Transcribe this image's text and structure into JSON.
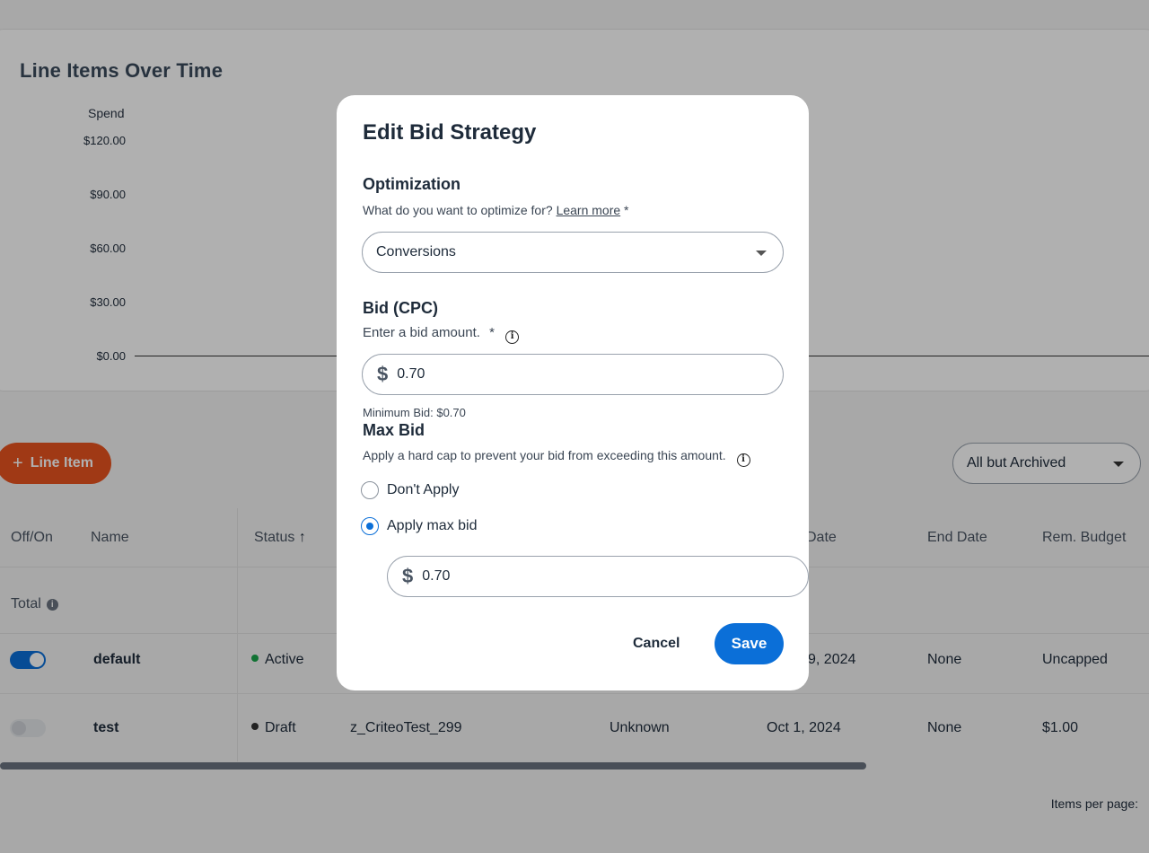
{
  "chart": {
    "title": "Line Items Over Time",
    "y_title": "Spend",
    "y_ticks": [
      "$120.00",
      "$90.00",
      "$60.00",
      "$30.00",
      "$0.00"
    ]
  },
  "toolbar": {
    "add_label": "Line Item",
    "filter_value": "All but Archived"
  },
  "table": {
    "headers": {
      "off_on": "Off/On",
      "name": "Name",
      "status": "Status",
      "start_date_partial": "Date",
      "end_date": "End Date",
      "rem_budget": "Rem. Budget"
    },
    "total_label": "Total",
    "rows": [
      {
        "enabled": true,
        "name": "default",
        "status": "Active",
        "status_color": "#1aa64b",
        "campaign": "",
        "tracking": "",
        "start_date_partial": "9, 2024",
        "end_date": "None",
        "rem_budget": "Uncapped"
      },
      {
        "enabled": false,
        "name": "test",
        "status": "Draft",
        "status_color": "#333333",
        "campaign": "z_CriteoTest_299",
        "tracking": "Unknown",
        "start_date": "Oct 1, 2024",
        "end_date": "None",
        "rem_budget": "$1.00"
      }
    ]
  },
  "pagination": {
    "items_per_page_label": "Items per page:"
  },
  "modal": {
    "title": "Edit Bid Strategy",
    "optimization": {
      "heading": "Optimization",
      "question": "What do you want to optimize for?",
      "learn_more": "Learn more",
      "required": "*",
      "selected": "Conversions"
    },
    "bid": {
      "heading": "Bid (CPC)",
      "prompt": "Enter a bid amount.",
      "required": "*",
      "currency": "$",
      "value": "0.70",
      "minimum_hint": "Minimum Bid: $0.70"
    },
    "max_bid": {
      "heading": "Max Bid",
      "description": "Apply a hard cap to prevent your bid from exceeding this amount.",
      "option_dont_apply": "Don't Apply",
      "option_apply": "Apply max bid",
      "selected_option": "Apply max bid",
      "currency": "$",
      "value": "0.70"
    },
    "cancel_label": "Cancel",
    "save_label": "Save"
  },
  "colors": {
    "accent_blue": "#0b6fd8",
    "add_button_orange": "#e8531f",
    "status_active": "#1aa64b"
  }
}
